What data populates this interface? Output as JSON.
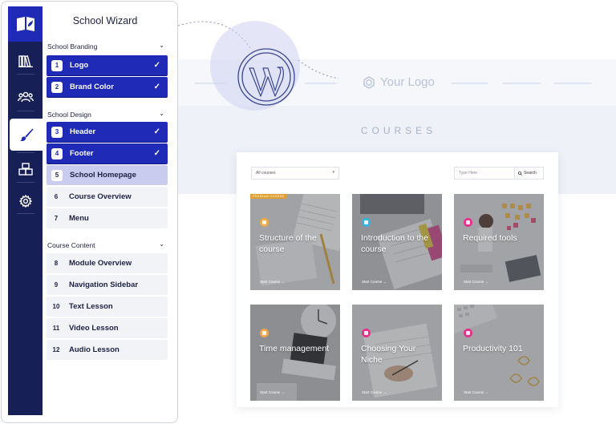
{
  "wizard": {
    "title": "School Wizard",
    "sections": [
      {
        "title": "School Branding",
        "steps": [
          {
            "num": "1",
            "label": "Logo",
            "state": "done"
          },
          {
            "num": "2",
            "label": "Brand Color",
            "state": "done"
          }
        ]
      },
      {
        "title": "School Design",
        "steps": [
          {
            "num": "3",
            "label": "Header",
            "state": "done"
          },
          {
            "num": "4",
            "label": "Footer",
            "state": "done"
          },
          {
            "num": "5",
            "label": "School Homepage",
            "state": "current"
          },
          {
            "num": "6",
            "label": "Course Overview",
            "state": "todo"
          },
          {
            "num": "7",
            "label": "Menu",
            "state": "todo"
          }
        ]
      },
      {
        "title": "Course Content",
        "steps": [
          {
            "num": "8",
            "label": "Module Overview",
            "state": "todo"
          },
          {
            "num": "9",
            "label": "Navigation Sidebar",
            "state": "todo"
          },
          {
            "num": "10",
            "label": "Text Lesson",
            "state": "todo"
          },
          {
            "num": "11",
            "label": "Video Lesson",
            "state": "todo"
          },
          {
            "num": "12",
            "label": "Audio Lesson",
            "state": "todo"
          }
        ]
      }
    ],
    "check_glyph": "✓",
    "chevron_glyph": "⌄"
  },
  "rail": {
    "icons": [
      "book-open-icon",
      "library-icon",
      "users-icon",
      "brush-icon",
      "boxes-icon",
      "gear-icon"
    ],
    "active": "brush-icon"
  },
  "preview": {
    "logo_text": "Your Logo",
    "courses_heading": "COURSES",
    "filter": {
      "selected": "All courses",
      "caret": "▾"
    },
    "search": {
      "placeholder": "Type Here",
      "button": "Search"
    },
    "premium_badge": "PREMIUM COURSE",
    "cards": [
      {
        "title": "Structure of the course",
        "start": "Start Course  →",
        "dot_color": "#f2a84b"
      },
      {
        "title": "Introduction to the course",
        "start": "Start Course  →",
        "dot_color": "#2db7e3"
      },
      {
        "title": "Required tools",
        "start": "Start Course  →",
        "dot_color": "#e6318a"
      },
      {
        "title": "Time management",
        "start": "Start Course  →",
        "dot_color": "#f2a84b"
      },
      {
        "title": "Choosing Your Niche",
        "start": "Start Course  →",
        "dot_color": "#e6318a"
      },
      {
        "title": "Productivity 101",
        "start": "Start Course  →",
        "dot_color": "#e6318a"
      }
    ]
  },
  "colors": {
    "accent": "#1f2bb7",
    "rail": "#161f56",
    "current_step": "#c9ccef"
  }
}
